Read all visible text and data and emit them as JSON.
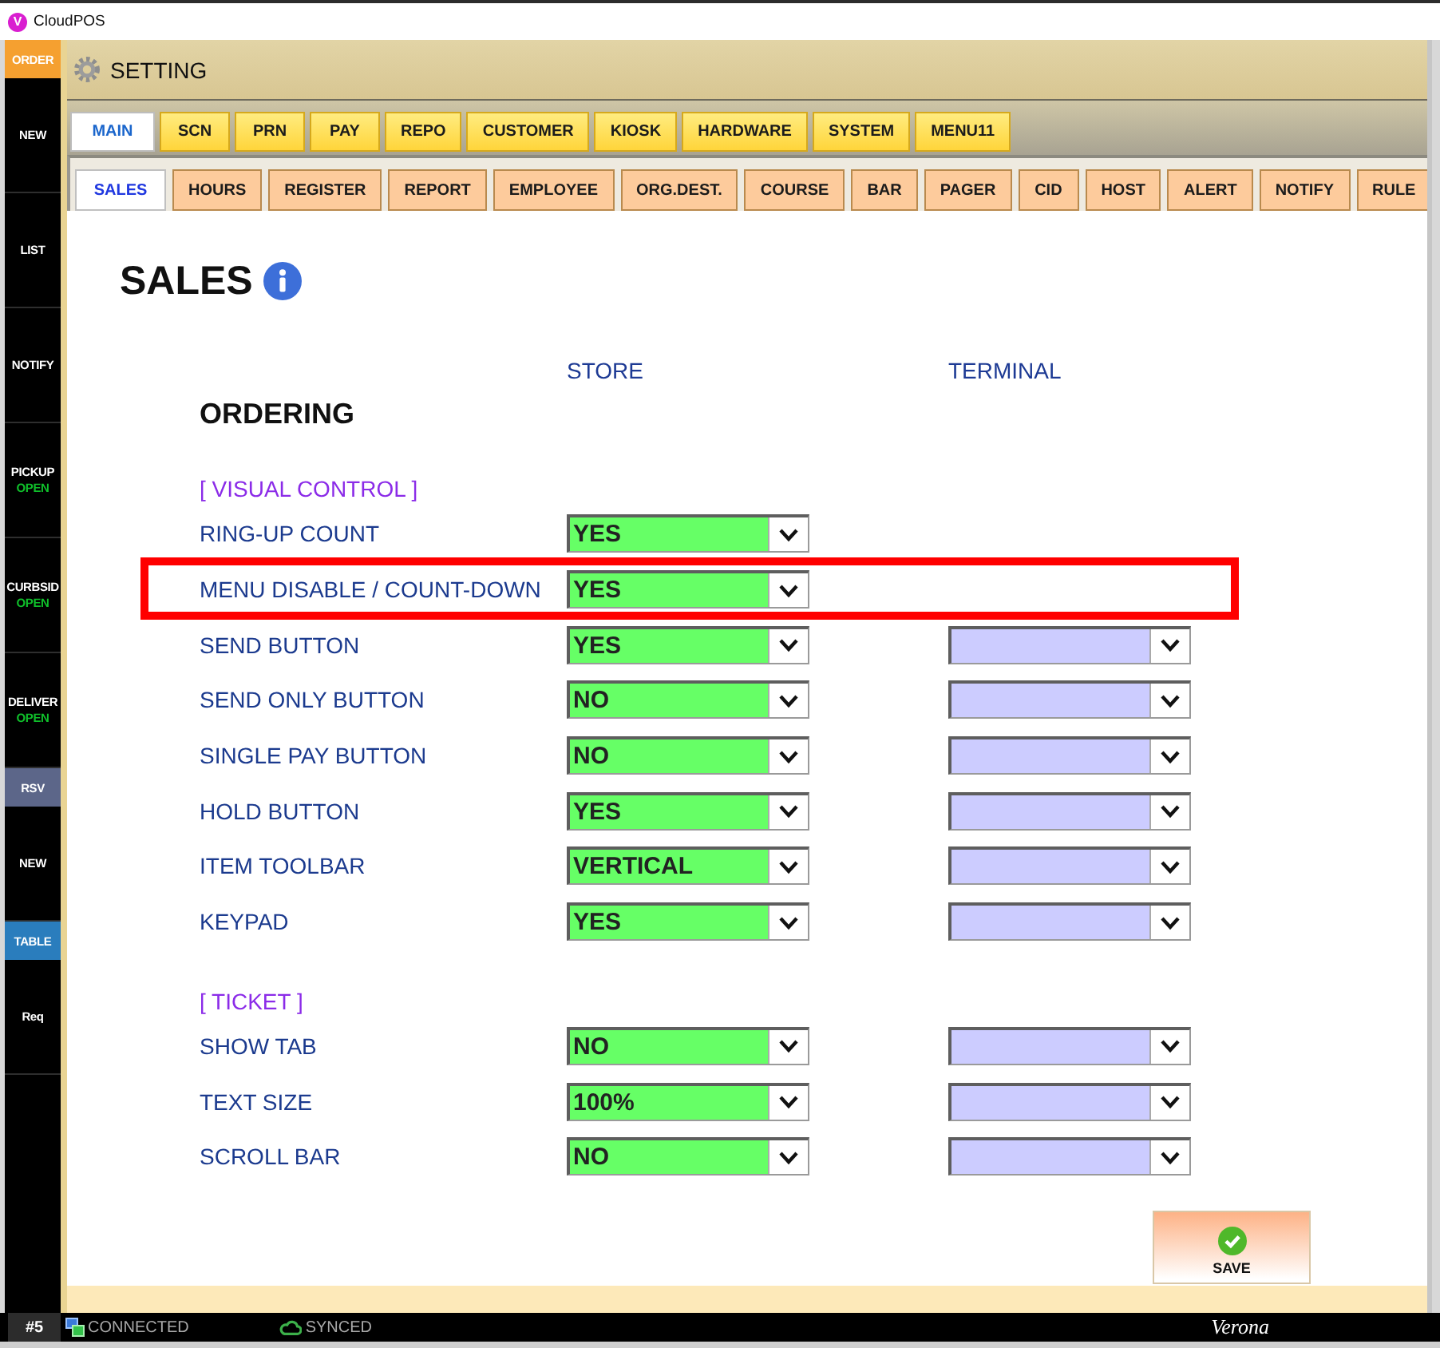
{
  "window": {
    "logo_letter": "V",
    "title": "CloudPOS"
  },
  "sidebar": {
    "items": [
      {
        "kind": "header",
        "label": "ORDER",
        "color": "#f5a030"
      },
      {
        "kind": "button",
        "label": "NEW"
      },
      {
        "kind": "button",
        "label": "LIST"
      },
      {
        "kind": "button",
        "label": "NOTIFY"
      },
      {
        "kind": "button",
        "label": "PICKUP",
        "status": "OPEN"
      },
      {
        "kind": "button",
        "label": "CURBSID",
        "status": "OPEN"
      },
      {
        "kind": "button",
        "label": "DELIVER",
        "status": "OPEN"
      },
      {
        "kind": "header",
        "label": "RSV",
        "color": "#5c6689"
      },
      {
        "kind": "button",
        "label": "NEW"
      },
      {
        "kind": "header",
        "label": "TABLE",
        "color": "#2a7dbd"
      },
      {
        "kind": "button",
        "label": "Req"
      }
    ]
  },
  "header": {
    "title": "SETTING"
  },
  "main_tabs": [
    {
      "label": "MAIN",
      "selected": true
    },
    {
      "label": "SCN",
      "selected": false
    },
    {
      "label": "PRN",
      "selected": false
    },
    {
      "label": "PAY",
      "selected": false
    },
    {
      "label": "REPO",
      "selected": false
    },
    {
      "label": "CUSTOMER",
      "selected": false
    },
    {
      "label": "KIOSK",
      "selected": false
    },
    {
      "label": "HARDWARE",
      "selected": false
    },
    {
      "label": "SYSTEM",
      "selected": false
    },
    {
      "label": "MENU11",
      "selected": false
    }
  ],
  "sub_tabs": [
    {
      "label": "SALES",
      "selected": true
    },
    {
      "label": "HOURS",
      "selected": false
    },
    {
      "label": "REGISTER",
      "selected": false
    },
    {
      "label": "REPORT",
      "selected": false
    },
    {
      "label": "EMPLOYEE",
      "selected": false
    },
    {
      "label": "ORG.DEST.",
      "selected": false
    },
    {
      "label": "COURSE",
      "selected": false
    },
    {
      "label": "BAR",
      "selected": false
    },
    {
      "label": "PAGER",
      "selected": false
    },
    {
      "label": "CID",
      "selected": false
    },
    {
      "label": "HOST",
      "selected": false
    },
    {
      "label": "ALERT",
      "selected": false
    },
    {
      "label": "NOTIFY",
      "selected": false
    },
    {
      "label": "RULE",
      "selected": false
    }
  ],
  "page": {
    "title": "SALES",
    "columns": [
      "STORE",
      "TERMINAL"
    ],
    "group_title": "ORDERING",
    "sections": [
      {
        "title": "[ VISUAL CONTROL ]",
        "rows": [
          {
            "label": "RING-UP COUNT",
            "store": "YES",
            "terminal_field": false,
            "highlighted": false
          },
          {
            "label": "MENU DISABLE / COUNT-DOWN",
            "store": "YES",
            "terminal_field": false,
            "highlighted": true
          },
          {
            "label": "SEND BUTTON",
            "store": "YES",
            "terminal_field": true,
            "highlighted": false
          },
          {
            "label": "SEND ONLY BUTTON",
            "store": "NO",
            "terminal_field": true,
            "highlighted": false
          },
          {
            "label": "SINGLE PAY BUTTON",
            "store": "NO",
            "terminal_field": true,
            "highlighted": false
          },
          {
            "label": "HOLD BUTTON",
            "store": "YES",
            "terminal_field": true,
            "highlighted": false
          },
          {
            "label": "ITEM TOOLBAR",
            "store": "VERTICAL",
            "terminal_field": true,
            "highlighted": false
          },
          {
            "label": "KEYPAD",
            "store": "YES",
            "terminal_field": true,
            "highlighted": false
          }
        ]
      },
      {
        "title": "[ TICKET ]",
        "rows": [
          {
            "label": "SHOW TAB",
            "store": "NO",
            "terminal_field": true,
            "highlighted": false
          },
          {
            "label": "TEXT SIZE",
            "store": "100%",
            "terminal_field": true,
            "highlighted": false
          },
          {
            "label": "SCROLL BAR",
            "store": "NO",
            "terminal_field": true,
            "highlighted": false
          }
        ]
      }
    ]
  },
  "save_button": {
    "label": "SAVE"
  },
  "status_bar": {
    "terminal": "#5",
    "connection": "CONNECTED",
    "sync": "SYNCED",
    "store_name": "Verona"
  }
}
